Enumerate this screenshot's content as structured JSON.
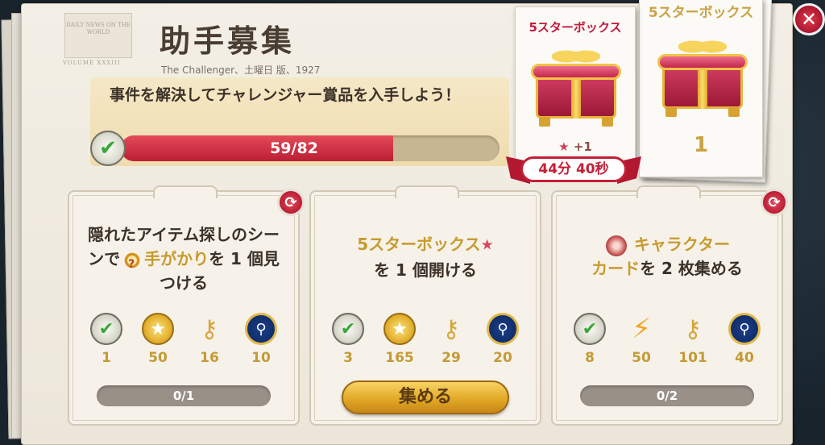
{
  "header": {
    "title": "助手募集",
    "subtitle": "The Challenger、土曜日 版、1927",
    "stamp_top": "DAILY NEWS ON THE WORLD",
    "stamp_bottom": "VOLUME XXXIII"
  },
  "mission": {
    "text": "事件を解決してチャレンジャー賞品を入手しよう！",
    "progress_text": "59/82",
    "progress_fraction": 0.7195
  },
  "rewards_preview": {
    "current": {
      "title": "5スターボックス",
      "bonus": "+1",
      "timer": "44分 40秒"
    },
    "total": {
      "title": "5スターボックス",
      "count": "1"
    }
  },
  "tasks": [
    {
      "text_part1": "隠れたアイテム探しのシーンで",
      "text_highlight": "手がかり",
      "text_part2": "を 1 個見つける",
      "rewards": [
        {
          "icon": "check-icon",
          "value": "1"
        },
        {
          "icon": "coin-icon",
          "value": "50"
        },
        {
          "icon": "key-icon",
          "value": "16"
        },
        {
          "icon": "magnifier-badge-icon",
          "value": "10"
        }
      ],
      "status": "0/1"
    },
    {
      "text_highlight": "5スターボックス",
      "text_part2": "を 1 個開ける",
      "rewards": [
        {
          "icon": "check-icon",
          "value": "3"
        },
        {
          "icon": "coin-icon",
          "value": "165"
        },
        {
          "icon": "key-icon",
          "value": "29"
        },
        {
          "icon": "magnifier-badge-icon",
          "value": "20"
        }
      ],
      "action_label": "集める"
    },
    {
      "text_highlight1": "キャラクター",
      "text_highlight2": "カード",
      "text_part2": "を 2 枚集める",
      "rewards": [
        {
          "icon": "check-icon",
          "value": "8"
        },
        {
          "icon": "energy-bolt-icon",
          "value": "50"
        },
        {
          "icon": "key-icon",
          "value": "101"
        },
        {
          "icon": "magnifier-badge-icon",
          "value": "40"
        }
      ],
      "status": "0/2"
    }
  ],
  "colors": {
    "accent_red": "#c31f37",
    "gold": "#c49a35",
    "paper": "#f3efe6"
  }
}
